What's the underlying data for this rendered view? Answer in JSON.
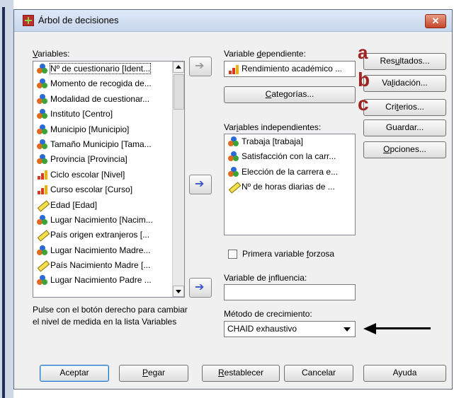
{
  "window": {
    "title": "Árbol de decisiones",
    "close_glyph": "✕"
  },
  "variables": {
    "label_prefix": "V",
    "label_rest": "ariables:",
    "items": [
      {
        "label": "Nº de cuestionario [Ident...",
        "icon": "nominal-icon"
      },
      {
        "label": "Momento de recogida de...",
        "icon": "nominal-icon"
      },
      {
        "label": "Modalidad de cuestionar...",
        "icon": "nominal-icon"
      },
      {
        "label": "Instituto [Centro]",
        "icon": "nominal-icon"
      },
      {
        "label": "Municipio [Municipio]",
        "icon": "nominal-icon"
      },
      {
        "label": "Tamaño Municipio [Tama...",
        "icon": "nominal-icon"
      },
      {
        "label": "Provincia [Provincia]",
        "icon": "nominal-icon"
      },
      {
        "label": "Ciclo escolar [Nivel]",
        "icon": "ordinal-icon"
      },
      {
        "label": "Curso escolar [Curso]",
        "icon": "ordinal-icon"
      },
      {
        "label": "Edad [Edad]",
        "icon": "scale-icon"
      },
      {
        "label": "Lugar Nacimiento [Nacim...",
        "icon": "nominal-icon"
      },
      {
        "label": "País origen extranjeros [...",
        "icon": "scale-icon"
      },
      {
        "label": "Lugar Nacimiento Madre...",
        "icon": "nominal-icon"
      },
      {
        "label": "País Nacimiento Madre [...",
        "icon": "scale-icon"
      },
      {
        "label": "Lugar Nacimiento Padre ...",
        "icon": "nominal-icon"
      }
    ]
  },
  "dependent": {
    "label_pre": "Variable ",
    "label_u": "d",
    "label_post": "ependiente:",
    "value": "Rendimiento académico ...",
    "categories_pre": "",
    "categories_u": "C",
    "categories_post": "ategorías..."
  },
  "independents": {
    "label_pre": "Var",
    "label_u": "i",
    "label_post": "ables independientes:",
    "items": [
      {
        "label": "Trabaja [trabaja]",
        "icon": "nominal-icon"
      },
      {
        "label": "Satisfacción con la carr...",
        "icon": "nominal-icon"
      },
      {
        "label": "Elección de la carrera e...",
        "icon": "nominal-icon"
      },
      {
        "label": "Nº de horas diarias de ...",
        "icon": "scale-icon"
      }
    ]
  },
  "force_first": {
    "label_pre": "Primera variable ",
    "label_u": "f",
    "label_post": "orzosa"
  },
  "influence": {
    "label_pre": "Variable de ",
    "label_u": "i",
    "label_post": "nfluencia:",
    "value": ""
  },
  "growth": {
    "label": "Método de crecimiento:",
    "selected": "CHAID exhaustivo"
  },
  "note": "Pulse con el botón derecho para cambiar el nivel de medida en la lista Variables",
  "side_buttons": [
    {
      "pre": "Res",
      "u": "u",
      "post": "ltados..."
    },
    {
      "pre": "Va",
      "u": "l",
      "post": "idación..."
    },
    {
      "pre": "Cri",
      "u": "t",
      "post": "erios..."
    },
    {
      "pre": "Guardar...",
      "u": "",
      "post": ""
    },
    {
      "pre": "",
      "u": "O",
      "post": "pciones..."
    }
  ],
  "annotations": {
    "a": "a",
    "b": "b",
    "c": "c"
  },
  "bottom_buttons": {
    "accept": "Aceptar",
    "paste_u": "P",
    "paste_rest": "egar",
    "reset_u": "R",
    "reset_rest": "establecer",
    "cancel": "Cancelar",
    "help": "Ayuda"
  },
  "arrow_glyph": "➔",
  "colors": {
    "annotation": "#a02222",
    "arrow_blue": "#3b55c7",
    "title_bar": "#c7d6ec"
  }
}
